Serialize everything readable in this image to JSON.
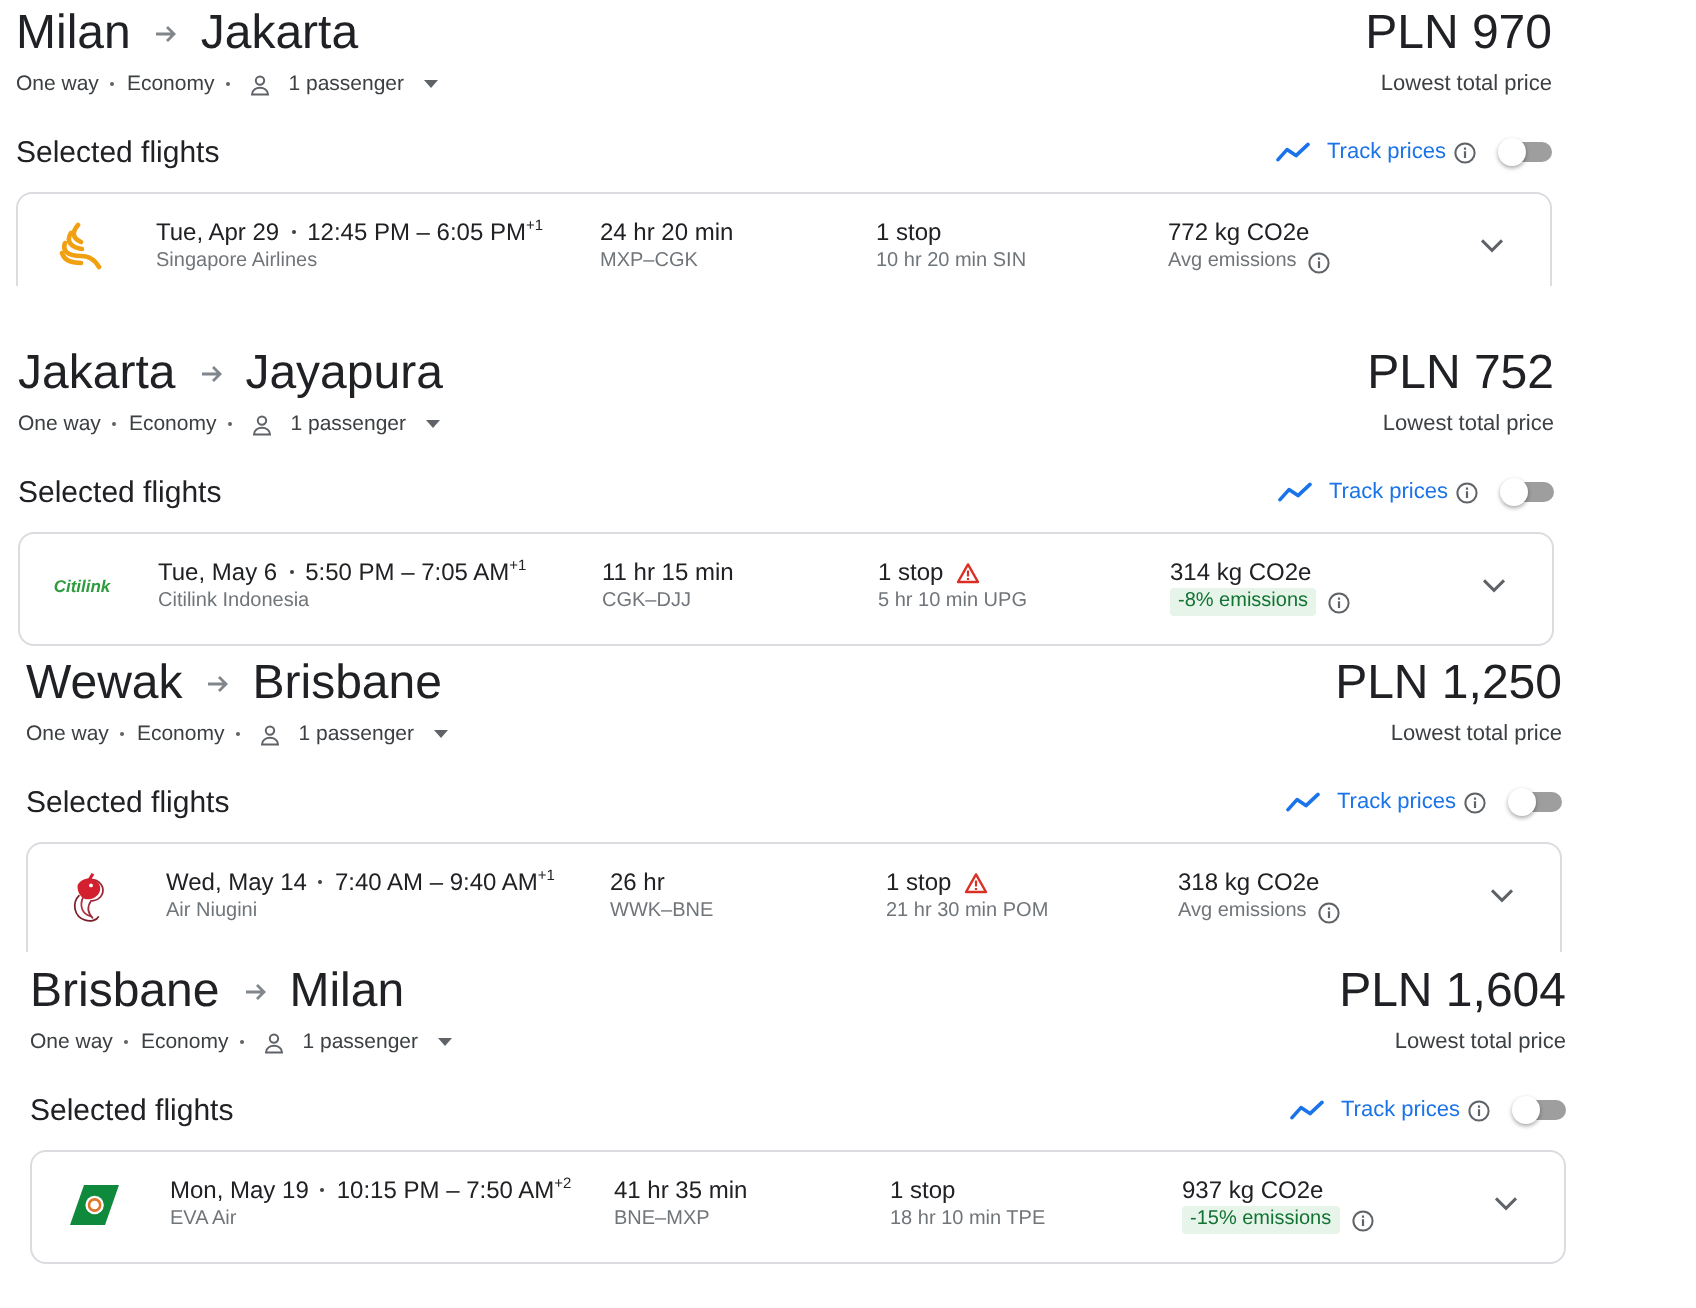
{
  "trips": [
    {
      "origin": "Milan",
      "destination": "Jakarta",
      "price": "PLN 970",
      "price_label": "Lowest total price",
      "trip_type": "One way",
      "cabin": "Economy",
      "passengers": "1 passenger",
      "section_title": "Selected flights",
      "track_prices": {
        "label": "Track prices",
        "on": false
      },
      "flight": {
        "logo": {
          "kind": "swirl"
        },
        "date": "Tue, Apr 29",
        "times": "12:45 PM – 6:05 PM$^{+1}$",
        "airline": "Singapore Airlines",
        "duration": "24 hr 20 min",
        "route": "MXP–CGK",
        "stops": "1 stop",
        "stop_warning": false,
        "layover": "10 hr 20 min SIN",
        "emissions": "772 kg CO2e",
        "emissions_note": {
          "kind": "plain",
          "text": "Avg emissions"
        }
      }
    },
    {
      "origin": "Jakarta",
      "destination": "Jayapura",
      "price": "PLN 752",
      "price_label": "Lowest total price",
      "trip_type": "One way",
      "cabin": "Economy",
      "passengers": "1 passenger",
      "section_title": "Selected flights",
      "track_prices": {
        "label": "Track prices",
        "on": false
      },
      "flight": {
        "logo": {
          "kind": "wordmark",
          "text": "Citilink"
        },
        "date": "Tue, May 6",
        "times": "5:50 PM – 7:05 AM$^{+1}$",
        "airline": "Citilink Indonesia",
        "duration": "11 hr 15 min",
        "route": "CGK–DJJ",
        "stops": "1 stop",
        "stop_warning": true,
        "layover": "5 hr 10 min UPG",
        "emissions": "314 kg CO2e",
        "emissions_note": {
          "kind": "badge",
          "text": "-8% emissions"
        }
      }
    },
    {
      "origin": "Wewak",
      "destination": "Brisbane",
      "price": "PLN 1,250",
      "price_label": "Lowest total price",
      "trip_type": "One way",
      "cabin": "Economy",
      "passengers": "1 passenger",
      "section_title": "Selected flights",
      "track_prices": {
        "label": "Track prices",
        "on": false
      },
      "flight": {
        "logo": {
          "kind": "bird"
        },
        "date": "Wed, May 14",
        "times": "7:40 AM – 9:40 AM$^{+1}$",
        "airline": "Air Niugini",
        "duration": "26 hr",
        "route": "WWK–BNE",
        "stops": "1 stop",
        "stop_warning": true,
        "layover": "21 hr 30 min POM",
        "emissions": "318 kg CO2e",
        "emissions_note": {
          "kind": "plain",
          "text": "Avg emissions"
        }
      }
    },
    {
      "origin": "Brisbane",
      "destination": "Milan",
      "price": "PLN 1,604",
      "price_label": "Lowest total price",
      "trip_type": "One way",
      "cabin": "Economy",
      "passengers": "1 passenger",
      "section_title": "Selected flights",
      "track_prices": {
        "label": "Track prices",
        "on": false
      },
      "flight": {
        "logo": {
          "kind": "tail"
        },
        "date": "Mon, May 19",
        "times": "10:15 PM – 7:50 AM$^{+2}$",
        "airline": "EVA Air",
        "duration": "41 hr 35 min",
        "route": "BNE–MXP",
        "stops": "1 stop",
        "stop_warning": false,
        "layover": "18 hr 10 min TPE",
        "emissions": "937 kg CO2e",
        "emissions_note": {
          "kind": "badge",
          "text": "-15% emissions"
        }
      }
    }
  ]
}
